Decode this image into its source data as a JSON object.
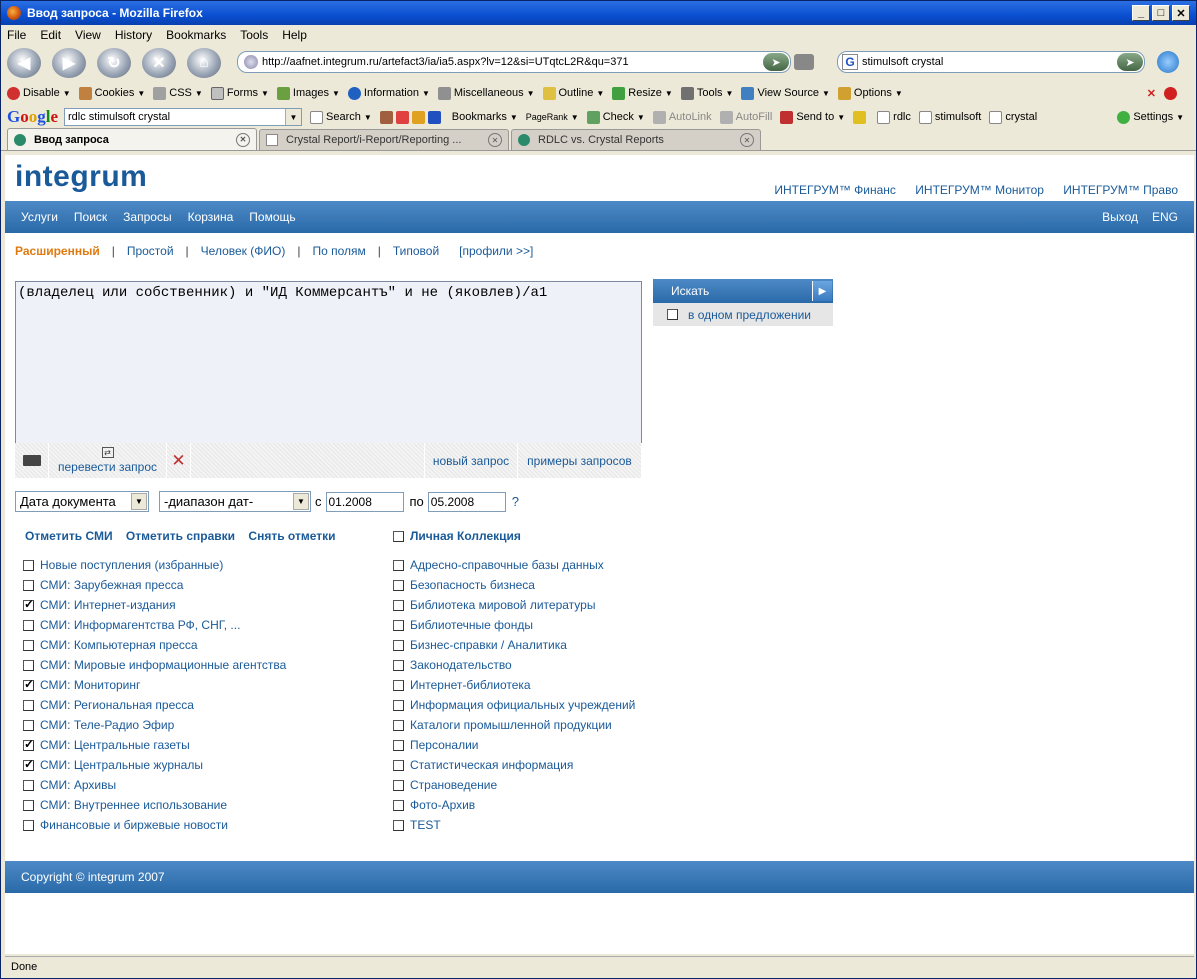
{
  "window": {
    "title": "Ввод запроса - Mozilla Firefox"
  },
  "menu": [
    "File",
    "Edit",
    "View",
    "History",
    "Bookmarks",
    "Tools",
    "Help"
  ],
  "nav": {
    "url": "http://aafnet.integrum.ru/artefact3/ia/ia5.aspx?lv=12&si=UTqtcL2R&qu=371",
    "search_value": "stimulsoft crystal"
  },
  "toolbar1": [
    "Disable",
    "Cookies",
    "CSS",
    "Forms",
    "Images",
    "Information",
    "Miscellaneous",
    "Outline",
    "Resize",
    "Tools",
    "View Source",
    "Options"
  ],
  "toolbar2": {
    "google_value": "rdlc stimulsoft crystal",
    "items": [
      "Search",
      "Bookmarks",
      "PageRank",
      "Check",
      "AutoLink",
      "AutoFill",
      "Send to",
      "rdlc",
      "stimulsoft",
      "crystal",
      "Settings"
    ]
  },
  "tabs": [
    {
      "label": "Ввод запроса",
      "active": true
    },
    {
      "label": "Crystal Report/i-Report/Reporting ...",
      "active": false
    },
    {
      "label": "RDLC vs. Crystal Reports",
      "active": false
    }
  ],
  "site": {
    "logo": "integrum",
    "top_links": [
      "ИНТЕГРУМ™ Финанс",
      "ИНТЕГРУМ™ Монитор",
      "ИНТЕГРУМ™ Право"
    ],
    "nav_left": [
      "Услуги",
      "Поиск",
      "Запросы",
      "Корзина",
      "Помощь"
    ],
    "nav_right": [
      "Выход",
      "ENG"
    ],
    "subtabs": {
      "active": "Расширенный",
      "items": [
        "Простой",
        "Человек (ФИО)",
        "По полям",
        "Типовой"
      ],
      "profiles": "[профили >>]"
    },
    "query_text": "(владелец или собственник) и \"ИД Коммерсантъ\" и не (яковлев)/a1",
    "query_tools": {
      "translate": "перевести запрос",
      "new_query": "новый запрос",
      "examples": "примеры запросов"
    },
    "search_button": "Искать",
    "one_sentence": "в одном предложении",
    "date": {
      "field": "Дата документа",
      "range": "-диапазон дат-",
      "from_label": "с",
      "from": "01.2008",
      "to_label": "по",
      "to": "05.2008",
      "help": "?"
    },
    "mark_links": [
      "Отметить СМИ",
      "Отметить справки",
      "Снять отметки"
    ],
    "personal_collection": "Личная Коллекция",
    "sources_left": [
      {
        "label": "Новые поступления (избранные)",
        "checked": false
      },
      {
        "label": "СМИ: Зарубежная пресса",
        "checked": false
      },
      {
        "label": "СМИ: Интернет-издания",
        "checked": true
      },
      {
        "label": "СМИ: Информагентства РФ, СНГ, ...",
        "checked": false
      },
      {
        "label": "СМИ: Компьютерная пресса",
        "checked": false
      },
      {
        "label": "СМИ: Мировые информационные агентства",
        "checked": false
      },
      {
        "label": "СМИ: Мониторинг",
        "checked": true
      },
      {
        "label": "СМИ: Региональная пресса",
        "checked": false
      },
      {
        "label": "СМИ: Теле-Радио Эфир",
        "checked": false
      },
      {
        "label": "СМИ: Центральные газеты",
        "checked": true
      },
      {
        "label": "СМИ: Центральные журналы",
        "checked": true
      },
      {
        "label": "СМИ: Архивы",
        "checked": false
      },
      {
        "label": "СМИ: Внутреннее использование",
        "checked": false
      },
      {
        "label": "Финансовые и биржевые новости",
        "checked": false
      }
    ],
    "sources_right": [
      {
        "label": "Адресно-справочные базы данных",
        "checked": false
      },
      {
        "label": "Безопасность бизнеса",
        "checked": false
      },
      {
        "label": "Библиотека мировой литературы",
        "checked": false
      },
      {
        "label": "Библиотечные фонды",
        "checked": false
      },
      {
        "label": "Бизнес-справки / Аналитика",
        "checked": false
      },
      {
        "label": "Законодательство",
        "checked": false
      },
      {
        "label": "Интернет-библиотека",
        "checked": false
      },
      {
        "label": "Информация официальных учреждений",
        "checked": false
      },
      {
        "label": "Каталоги промышленной продукции",
        "checked": false
      },
      {
        "label": "Персоналии",
        "checked": false
      },
      {
        "label": "Статистическая информация",
        "checked": false
      },
      {
        "label": "Страноведение",
        "checked": false
      },
      {
        "label": "Фото-Архив",
        "checked": false
      },
      {
        "label": "TEST",
        "checked": false
      }
    ],
    "footer": "Copyright © integrum 2007"
  },
  "status": "Done",
  "colors": {
    "brand_blue": "#1a5a99",
    "nav_blue": "#3a7ab8",
    "active_tab": "#e07a10"
  }
}
